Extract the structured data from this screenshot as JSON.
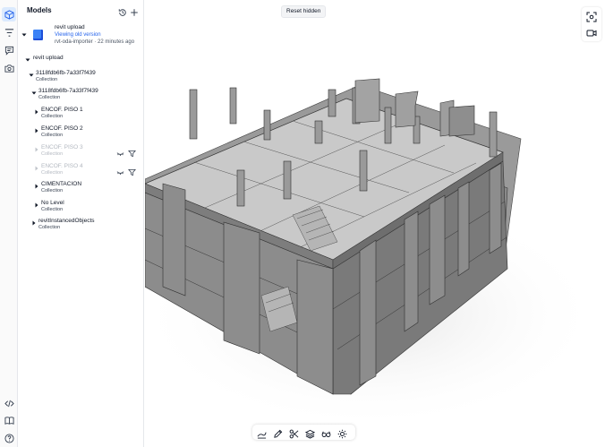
{
  "colors": {
    "accent": "#2563eb",
    "active_rail_bg": "#dbeafe",
    "model_thumb": "#3b82f6",
    "building": "#8e8e8e"
  },
  "rail": {
    "icons": [
      "cube-icon",
      "filter-icon",
      "comment-icon",
      "camera-icon",
      "code-icon",
      "book-icon",
      "help-icon"
    ]
  },
  "panel": {
    "title": "Models",
    "model": {
      "name": "revit upload",
      "link": "Viewing old version",
      "meta": "rvt-oda-importer · 22 minutes ago"
    },
    "tree": [
      {
        "label": "revit upload",
        "sub": ""
      },
      {
        "label": "3118fdb6fb-7a33f7f439",
        "sub": "Collection"
      },
      {
        "label": "3118fdb6fb-7a33f7f439",
        "sub": "Collection"
      },
      {
        "label": "ENCOF. PISO 1",
        "sub": "Collection"
      },
      {
        "label": "ENCOF. PISO 2",
        "sub": "Collection"
      },
      {
        "label": "ENCOF. PISO 3",
        "sub": "Collection"
      },
      {
        "label": "ENCOF. PISO 4",
        "sub": "Collection"
      },
      {
        "label": "CIMENTACION",
        "sub": "Collection"
      },
      {
        "label": "No Level",
        "sub": "Collection"
      },
      {
        "label": "revitInstancedObjects",
        "sub": "Collection"
      }
    ]
  },
  "viewer": {
    "reset_label": "Reset hidden",
    "side_tools": [
      "fit-view-icon",
      "camera-view-icon"
    ],
    "bottom_tools": [
      "measure-icon",
      "pencil-icon",
      "section-icon",
      "layers-icon",
      "glasses-icon",
      "sun-icon"
    ]
  }
}
